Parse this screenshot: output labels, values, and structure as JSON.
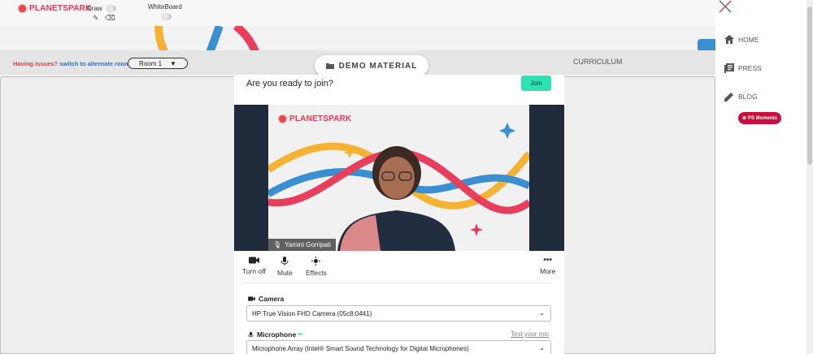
{
  "header": {
    "logo_text": "PLANETSPARK",
    "draw_label": "Draw",
    "whiteboard_label": "WhiteBoard"
  },
  "issues": {
    "prefix": "Having issues?",
    "link": "switch to alternate room"
  },
  "room_select": {
    "value": "Room 1"
  },
  "demo_material": "DEMO MATERIAL",
  "curriculum": "CURRICULUM",
  "join_card": {
    "title": "Are you ready to join?",
    "join_label": "Join",
    "participant_name": "Yamini Gorripati",
    "video_logo": "PLANETSPARK",
    "controls": [
      {
        "label": "Turn off",
        "icon": "camera-icon"
      },
      {
        "label": "Mute",
        "icon": "microphone-icon"
      },
      {
        "label": "Effects",
        "icon": "sparkle-icon"
      },
      {
        "label": "More",
        "icon": "more-icon"
      }
    ],
    "camera": {
      "label": "Camera",
      "value": "HP True Vision FHD Camera (05c8:0441)"
    },
    "microphone": {
      "label": "Microphone",
      "value": "Microphone Array (Intel® Smart Sound Technology for Digital Microphones)",
      "test_label": "Test your mic"
    }
  },
  "sidebar": {
    "items": [
      {
        "label": "HOME",
        "icon": "home-icon"
      },
      {
        "label": "PRESS",
        "icon": "press-icon"
      },
      {
        "label": "BLOG",
        "icon": "pencil-icon"
      }
    ],
    "ps_moments": "PS Moments"
  },
  "colors": {
    "brand_red": "#e23b4b",
    "join_green": "#2de3b1",
    "ps_moments": "#c8103e",
    "link_blue": "#2d6fd6"
  }
}
